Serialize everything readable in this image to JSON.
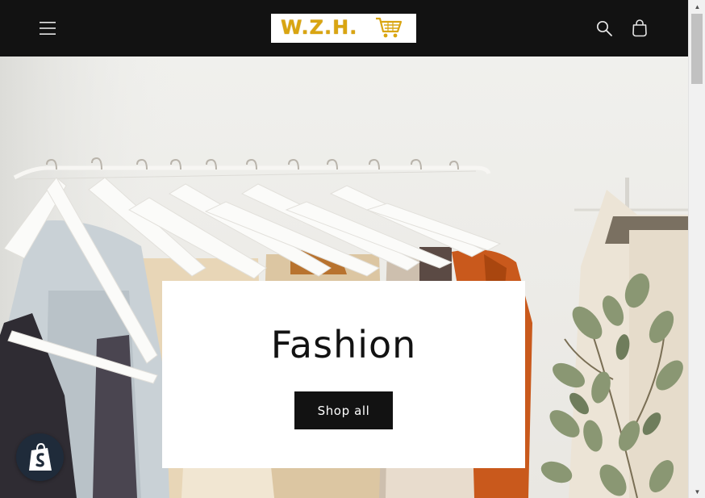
{
  "header": {
    "logo_text": "W.Z.H.",
    "icons": {
      "menu": "hamburger-menu-icon",
      "search": "search-icon",
      "cart": "cart-icon"
    }
  },
  "hero": {
    "title": "Fashion",
    "button_label": "Shop all"
  },
  "badge": {
    "icon": "shopify-bag-icon"
  },
  "scrollbar": {
    "up": "▲",
    "down": "▼"
  },
  "colors": {
    "header_bg": "#121212",
    "button_bg": "#121212",
    "logo_gold": "#d9a511",
    "badge_bg": "#1f2b3a"
  }
}
